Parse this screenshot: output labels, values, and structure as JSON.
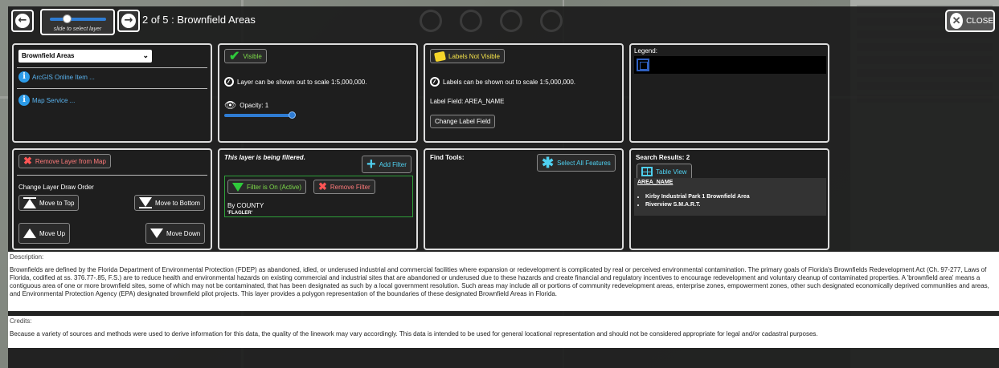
{
  "header": {
    "slider_caption": "slide to select layer",
    "title": "2 of 5 : Brownfield Areas",
    "close_label": "CLOSE"
  },
  "layer_panel": {
    "selected_layer": "Brownfield Areas",
    "arcgis_link": "ArcGIS Online Item ...",
    "map_service_link": "Map Service ..."
  },
  "visibility_panel": {
    "visible_label": "Visible",
    "scale_text": "Layer can be shown out to scale 1:5,000,000.",
    "opacity_label": "Opacity: 1",
    "opacity_value": 1
  },
  "labels_panel": {
    "labels_label": "Labels Not Visible",
    "scale_text": "Labels can be shown out to scale 1:5,000,000.",
    "label_field": "Label Field: AREA_NAME",
    "change_label_button": "Change Label Field"
  },
  "legend_panel": {
    "title": "Legend:"
  },
  "draw_order_panel": {
    "remove_button": "Remove Layer from Map",
    "title": "Change Layer Draw Order",
    "move_top": "Move to Top",
    "move_bottom": "Move to Bottom",
    "move_up": "Move Up",
    "move_down": "Move Down"
  },
  "filter_panel": {
    "filtered_text": "This layer is being filtered.",
    "add_filter": "Add Filter",
    "filter_on": "Filter is On (Active)",
    "remove_filter": "Remove Filter",
    "by_county": "By COUNTY",
    "county_value": "'FLAGLER'"
  },
  "find_panel": {
    "title": "Find Tools:",
    "select_all": "Select All Features"
  },
  "results_panel": {
    "title": "Search Results: 2",
    "table_view": "Table View",
    "column_header": "AREA_NAME",
    "results": [
      "Kirby Industrial Park 1 Brownfield Area",
      "Riverview S.M.A.R.T."
    ]
  },
  "description": {
    "label": "Description:",
    "text": "Brownfields are defined by the Florida Department of Environmental Protection (FDEP) as abandoned, idled, or underused industrial and commercial facilities where expansion or redevelopment is complicated by real or perceived environmental contamination. The primary goals of Florida's Brownfields Redevelopment Act (Ch. 97-277, Laws of Florida, codified at ss. 376.77-.85, F.S.) are to reduce health and environmental hazards on existing commercial and industrial sites that are abandoned or underused due to these hazards and create financial and regulatory incentives to encourage redevelopment and voluntary cleanup of contaminated properties. A 'brownfield area' means a contiguous area of one or more brownfield sites, some of which may not be contaminated, that has been designated as such by a local government resolution. Such areas may include all or portions of community redevelopment areas, enterprise zones, empowerment zones, other such designated economically deprived communities and areas, and Environmental Protection Agency (EPA) designated brownfield pilot projects. This layer provides a polygon representation of the boundaries of these designated Brownfield Areas in Florida."
  },
  "credits": {
    "label": "Credits:",
    "text": "Because a variety of sources and methods were used to derive information for this data, the quality of the linework may vary accordingly. This data is intended to be used for general locational representation and should not be considered appropriate for legal and/or cadastral purposes."
  }
}
